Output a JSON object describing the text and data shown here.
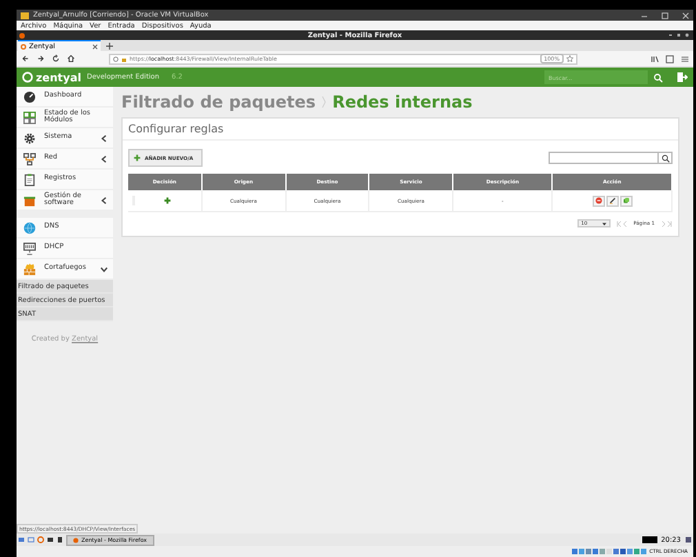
{
  "vbox": {
    "title": "Zentyal_Arnulfo [Corriendo] - Oracle VM VirtualBox",
    "menu": [
      "Archivo",
      "Máquina",
      "Ver",
      "Entrada",
      "Dispositivos",
      "Ayuda"
    ],
    "status_text": "CTRL DERECHA"
  },
  "firefox": {
    "title": "Zentyal - Mozilla Firefox",
    "tab": "Zentyal",
    "url_host": "localhost",
    "url_prefix": "https://",
    "url_path": ":8443/Firewall/View/InternalRuleTable",
    "zoom": "100%",
    "status_url": "https://localhost:8443/DHCP/View/Interfaces"
  },
  "header": {
    "logo": "zentyal",
    "edition": "Development Edition",
    "version": "6.2",
    "search_placeholder": "Buscar..."
  },
  "sidebar": {
    "items": [
      {
        "label": "Dashboard"
      },
      {
        "label": "Estado de los Módulos"
      },
      {
        "label": "Sistema",
        "expanded": false
      },
      {
        "label": "Red",
        "expanded": false
      },
      {
        "label": "Registros"
      },
      {
        "label": "Gestión de software",
        "expanded": false
      },
      {
        "label": "DNS"
      },
      {
        "label": "DHCP"
      },
      {
        "label": "Cortafuegos",
        "expanded": true,
        "children": [
          {
            "label": "Filtrado de paquetes"
          },
          {
            "label": "Redirecciones de puertos"
          },
          {
            "label": "SNAT"
          }
        ]
      }
    ],
    "footer_prefix": "Created by",
    "footer_link": "Zentyal"
  },
  "page": {
    "breadcrumb_parent": "Filtrado de paquetes",
    "breadcrumb_current": "Redes internas",
    "panel_title": "Configurar reglas",
    "add_button": "AÑADIR NUEVO/A",
    "table": {
      "columns": [
        "Decisión",
        "Origen",
        "Destino",
        "Servicio",
        "Descripción",
        "Acción"
      ],
      "rows": [
        {
          "origin": "Cualquiera",
          "destination": "Cualquiera",
          "service": "Cualquiera",
          "description": "-"
        }
      ]
    },
    "page_size": "10",
    "page_label": "Página 1"
  },
  "taskbar": {
    "window": "Zentyal - Mozilla Firefox",
    "clock": "20:23"
  }
}
